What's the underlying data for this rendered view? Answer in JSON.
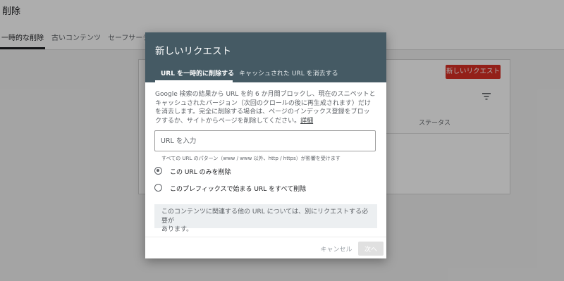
{
  "background": {
    "page_title": "削除",
    "tabs": [
      {
        "label": "一時的な削除",
        "active": true
      },
      {
        "label": "古いコンテンツ",
        "active": false
      },
      {
        "label": "セーフサーチ",
        "active": false
      }
    ],
    "new_request_label": "新しいリクエスト",
    "status_header": "ステータス",
    "filter_icon": "filter-icon"
  },
  "dialog": {
    "title": "新しいリクエスト",
    "tabs": [
      {
        "label": "URL を一時的に削除する",
        "active": true
      },
      {
        "label": "キャッシュされた URL を消去する",
        "active": false
      }
    ],
    "description_line1": "Google 検索の結果から URL を約 6 か月間ブロックし、現在のスニペットと",
    "description_line2": "キャッシュされたバージョン（次回のクロールの後に再生成されます）だけ",
    "description_line3": "を消去します。完全に削除する場合は、ページのインデックス登録をブロッ",
    "description_line4": "クするか、サイトからページを削除してください。",
    "description_link": "詳細",
    "url_input": {
      "placeholder": "URL を入力",
      "value": ""
    },
    "helper_text": "すべての URL のパターン（www / www 以外、http / https）が影響を受けます",
    "radio_options": [
      {
        "label": "この URL のみを削除",
        "checked": true
      },
      {
        "label": "このプレフィックスで始まる URL をすべて削除",
        "checked": false
      }
    ],
    "info_line1": "このコンテンツに関連する他の URL については、別にリクエストする必要が",
    "info_line2": "あります。",
    "cancel_label": "キャンセル",
    "next_label": "次へ"
  },
  "colors": {
    "dialog_header": "#455a64",
    "new_request_button": "#d93025",
    "info_box": "#eceff1"
  }
}
